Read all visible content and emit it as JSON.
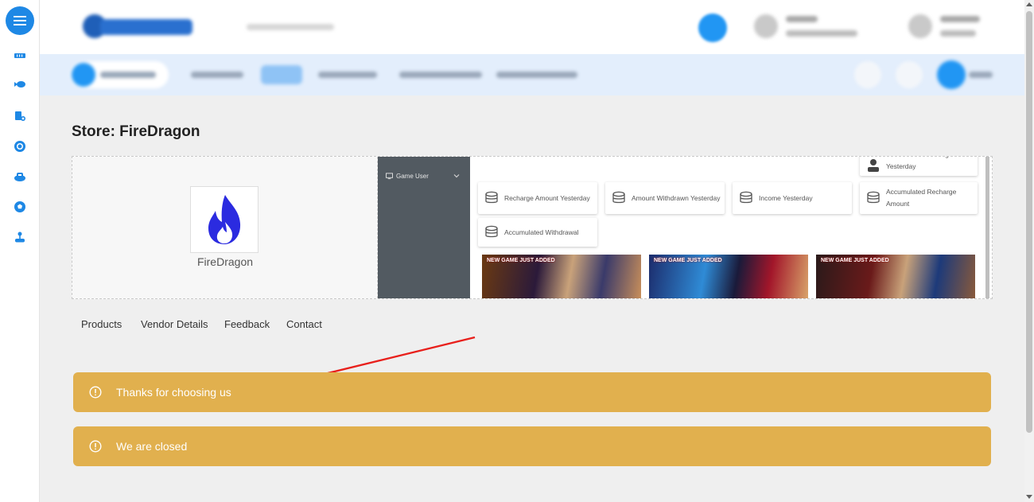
{
  "store": {
    "title": "Store: FireDragon",
    "name": "FireDragon"
  },
  "banner_screenshot": {
    "sidebar_item": "Game User",
    "cards": [
      {
        "label": "Number Of New Registrations Yesterday"
      },
      {
        "label": "Recharge Amount Yesterday"
      },
      {
        "label": "Amount Withdrawn Yesterday"
      },
      {
        "label": "Income Yesterday"
      },
      {
        "label": "Accumulated Recharge Amount"
      },
      {
        "label": "Accumulated Withdrawal"
      }
    ],
    "game_tag": "NEW GAME JUST ADDED"
  },
  "tabs": [
    "Products",
    "Vendor Details",
    "Feedback",
    "Contact"
  ],
  "alerts": [
    {
      "text": "Thanks for choosing us"
    },
    {
      "text": "We are closed"
    }
  ],
  "colors": {
    "accent": "#1e88e5",
    "alert": "#e1b04e",
    "annotation_arrow": "#e8201c",
    "flame": "#2b2be0"
  }
}
